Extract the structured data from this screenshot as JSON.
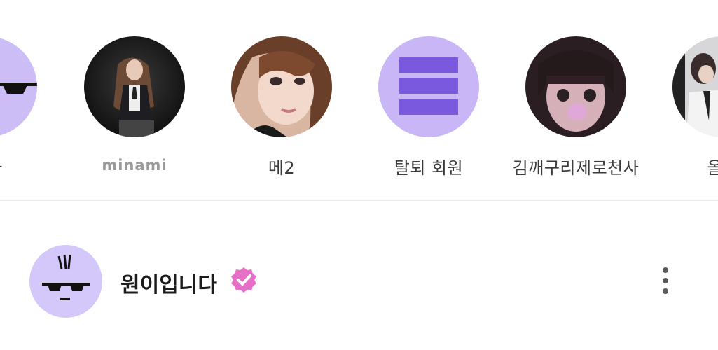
{
  "stories": [
    {
      "label": "니다",
      "avatar": "sunglasses-avatar",
      "color": "#cdbdf7"
    },
    {
      "label": "minami",
      "avatar": "photo-avatar"
    },
    {
      "label": "메2",
      "avatar": "photo-avatar"
    },
    {
      "label": "탈퇴 회원",
      "avatar": "deleted-member-avatar",
      "color": "#c8b6f6"
    },
    {
      "label": "김깨구리제로천사",
      "avatar": "photo-avatar"
    },
    {
      "label": "올리",
      "avatar": "photo-avatar"
    }
  ],
  "post": {
    "username": "원이입니다",
    "verified_color": "#e66fc8",
    "avatar": "sunglasses-avatar",
    "menu_icon": "more-vertical-icon"
  },
  "colors": {
    "lavender": "#cdbdf7",
    "purple_bar": "#7b59de",
    "divider": "#ececec"
  }
}
